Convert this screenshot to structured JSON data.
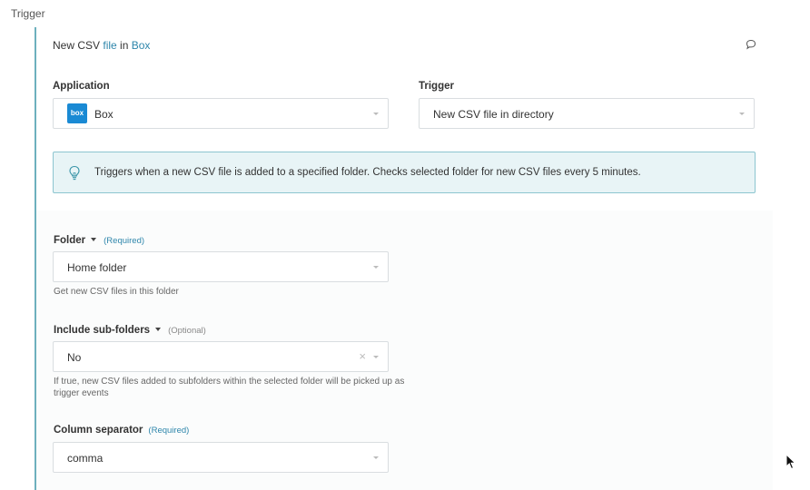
{
  "section": {
    "title": "Trigger"
  },
  "step": {
    "title_prefix": "New CSV ",
    "title_link1": "file",
    "title_mid": " in ",
    "title_link2": "Box"
  },
  "application": {
    "label": "Application",
    "value": "Box",
    "logo_text": "box"
  },
  "trigger": {
    "label": "Trigger",
    "value": "New CSV file in directory"
  },
  "info": {
    "text": "Triggers when a new CSV file is added to a specified folder. Checks selected folder for new CSV files every 5 minutes."
  },
  "folder": {
    "label": "Folder",
    "tag": "(Required)",
    "value": "Home folder",
    "hint": "Get new CSV files in this folder"
  },
  "include_subfolders": {
    "label": "Include sub-folders",
    "tag": "(Optional)",
    "value": "No",
    "clear_glyph": "×",
    "hint_line1": "If true, new CSV files added to subfolders within the selected folder will be picked up as",
    "hint_line2": "trigger events"
  },
  "column_separator": {
    "label": "Column separator",
    "tag": "(Required)",
    "value": "comma"
  },
  "colors": {
    "accent": "#2e86ab",
    "left_rule": "#6db0bd",
    "info_bg": "#e8f4f6",
    "info_border": "#8cc5d0",
    "box_brand": "#1a8ad4"
  },
  "icons": {
    "comment": "comment-icon",
    "bulb": "lightbulb-icon",
    "dropdown": "chevron-down-icon",
    "clear": "clear-icon"
  }
}
